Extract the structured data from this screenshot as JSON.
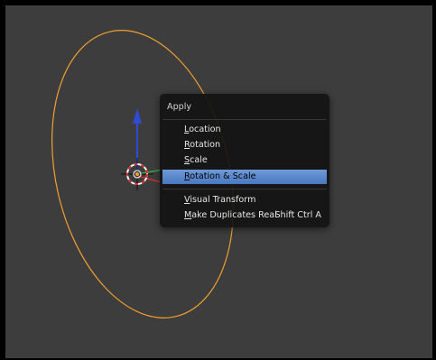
{
  "viewport": {
    "background_color": "#3d3d3d",
    "selected_outline_color": "#f0a030",
    "axis_colors": {
      "x": "#c83232",
      "y": "#3ea53e",
      "z": "#2e4bd6"
    }
  },
  "apply_menu": {
    "title": "Apply",
    "items": [
      {
        "label": "Location",
        "shortcut": "",
        "highlighted": false
      },
      {
        "label": "Rotation",
        "shortcut": "",
        "highlighted": false
      },
      {
        "label": "Scale",
        "shortcut": "",
        "highlighted": false
      },
      {
        "label": "Rotation & Scale",
        "shortcut": "",
        "highlighted": true
      },
      {
        "label": "Visual Transform",
        "shortcut": "",
        "highlighted": false
      },
      {
        "label": "Make Duplicates Real",
        "shortcut": "Shift Ctrl A",
        "highlighted": false
      }
    ],
    "highlight_color": "#5b87cc"
  }
}
